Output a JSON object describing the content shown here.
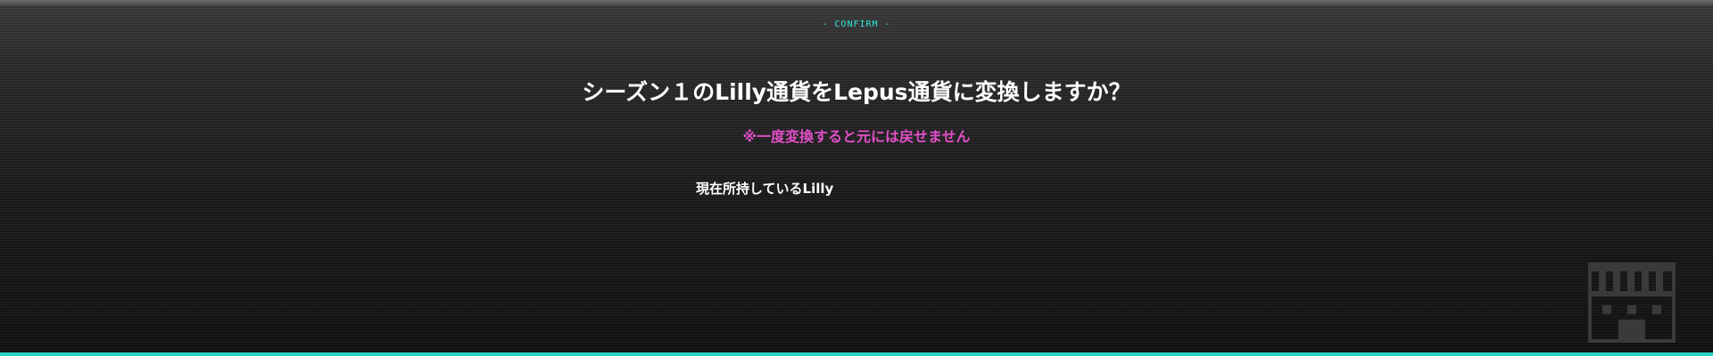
{
  "dialog": {
    "header_label": "- CONFIRM -",
    "question": "シーズン１のLilly通貨をLepus通貨に変換しますか？",
    "warning": "※一度変換すると元には戻せません",
    "holding_label": "現在所持しているLilly"
  },
  "icons": {
    "watermark": "shop-icon"
  },
  "colors": {
    "header_accent": "#2ee6d6",
    "warning": "#e24fc8",
    "bottom_accent": "#27d3c3",
    "text": "#ffffff"
  }
}
